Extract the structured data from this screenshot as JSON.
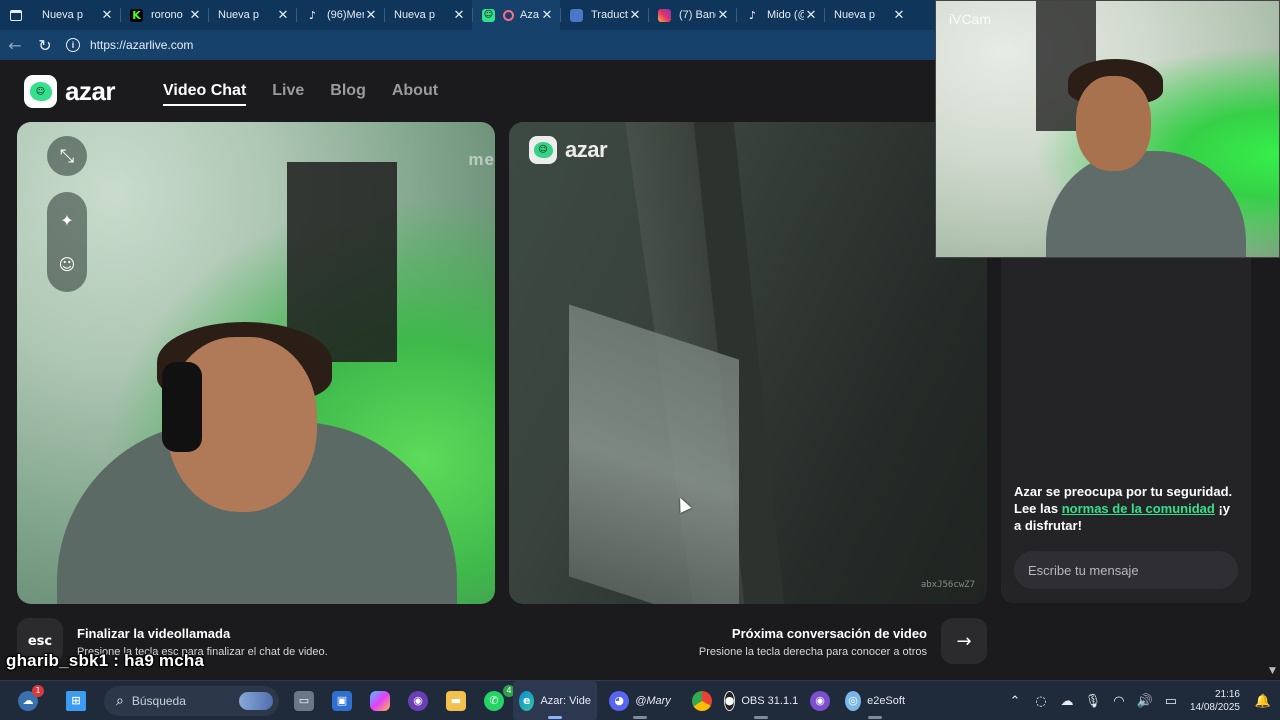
{
  "browser": {
    "tabs": [
      {
        "title": "Nueva p",
        "favicon": "page-icon"
      },
      {
        "title": "rorono",
        "favicon": "kick-icon"
      },
      {
        "title": "Nueva p",
        "favicon": "page-icon"
      },
      {
        "title": "(96)Men",
        "favicon": "tiktok-icon"
      },
      {
        "title": "Nueva p",
        "favicon": "page-icon"
      },
      {
        "title": "Aza",
        "favicon": "azar-icon",
        "active": true
      },
      {
        "title": "Traducto",
        "favicon": "docs-icon"
      },
      {
        "title": "(7) Band",
        "favicon": "instagram-icon"
      },
      {
        "title": "Mido (@",
        "favicon": "tiktok-icon"
      },
      {
        "title": "Nueva p",
        "favicon": "page-icon"
      }
    ],
    "url": "https://azarlive.com"
  },
  "site": {
    "brand": "azar",
    "nav": [
      "Video Chat",
      "Live",
      "Blog",
      "About"
    ],
    "active_nav": "Video Chat"
  },
  "video": {
    "my_watermark": "me",
    "peer_brand": "azar",
    "peer_id": "abxJ56cwZ7"
  },
  "actions": {
    "end_key": "esc",
    "end_title": "Finalizar la videollamada",
    "end_sub": "Presione la tecla esc para finalizar el chat de video.",
    "next_title": "Próxima conversación de video",
    "next_sub": "Presione la tecla derecha para conocer a otros",
    "next_key": "→"
  },
  "chat": {
    "safety_prefix": "Azar se preocupa por tu seguridad. Lee las ",
    "safety_link": "normas de la comunidad",
    "safety_suffix": " ¡y a disfrutar!",
    "input_placeholder": "Escribe tu mensaje"
  },
  "camera_overlay": {
    "label": "iVCam"
  },
  "stream_overlay": {
    "user": "gharib_sbk1",
    "separator": " : ",
    "message": "ha9 mcha"
  },
  "taskbar": {
    "search_placeholder": "Búsqueda",
    "weather_badge": "1",
    "whatsapp_badge": "4",
    "apps": [
      {
        "label": "Azar: Vide",
        "icon": "edge-icon"
      },
      {
        "label": "@Mary",
        "icon": "discord-icon"
      },
      {
        "label": "OBS 31.1.1",
        "icon": "obs-icon"
      },
      {
        "label": "e2eSoft",
        "icon": "ivcam-icon"
      }
    ],
    "time": "21:16",
    "date": "14/08/2025"
  },
  "colors": {
    "accent": "#35e08c",
    "tab_strip": "#0f355a",
    "page_bg": "#1b1b1d"
  }
}
